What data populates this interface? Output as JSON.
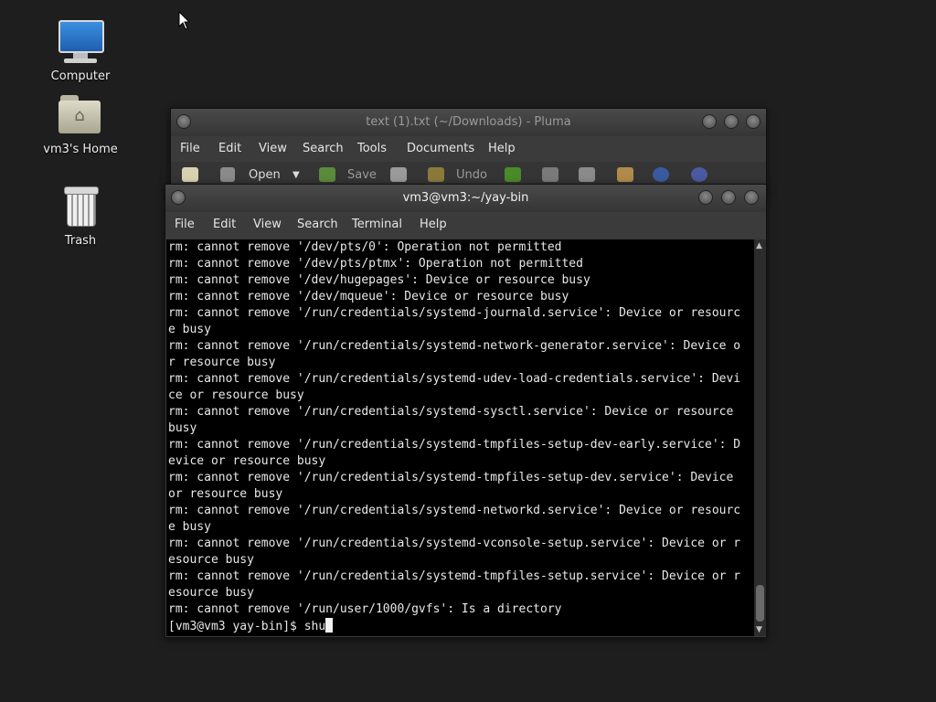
{
  "desktop": {
    "icons": [
      {
        "label": "Computer",
        "icon": "computer-icon"
      },
      {
        "label": "vm3's Home",
        "icon": "home-folder-icon"
      },
      {
        "label": "Trash",
        "icon": "trash-icon"
      }
    ]
  },
  "pluma": {
    "title": "text (1).txt (~/Downloads) - Pluma",
    "menu": [
      "File",
      "Edit",
      "View",
      "Search",
      "Tools",
      "Documents",
      "Help"
    ],
    "toolbar": {
      "open_label": "Open",
      "save_label": "Save",
      "undo_label": "Undo"
    }
  },
  "terminal": {
    "title": "vm3@vm3:~/yay-bin",
    "menu": [
      "File",
      "Edit",
      "View",
      "Search",
      "Terminal",
      "Help"
    ],
    "lines": [
      "rm: cannot remove '/dev/pts/0': Operation not permitted",
      "rm: cannot remove '/dev/pts/ptmx': Operation not permitted",
      "rm: cannot remove '/dev/hugepages': Device or resource busy",
      "rm: cannot remove '/dev/mqueue': Device or resource busy",
      "rm: cannot remove '/run/credentials/systemd-journald.service': Device or resourc",
      "e busy",
      "rm: cannot remove '/run/credentials/systemd-network-generator.service': Device o",
      "r resource busy",
      "rm: cannot remove '/run/credentials/systemd-udev-load-credentials.service': Devi",
      "ce or resource busy",
      "rm: cannot remove '/run/credentials/systemd-sysctl.service': Device or resource",
      "busy",
      "rm: cannot remove '/run/credentials/systemd-tmpfiles-setup-dev-early.service': D",
      "evice or resource busy",
      "rm: cannot remove '/run/credentials/systemd-tmpfiles-setup-dev.service': Device",
      "or resource busy",
      "rm: cannot remove '/run/credentials/systemd-networkd.service': Device or resourc",
      "e busy",
      "rm: cannot remove '/run/credentials/systemd-vconsole-setup.service': Device or r",
      "esource busy",
      "rm: cannot remove '/run/credentials/systemd-tmpfiles-setup.service': Device or r",
      "esource busy",
      "rm: cannot remove '/run/user/1000/gvfs': Is a directory"
    ],
    "prompt": "[vm3@vm3 yay-bin]$ ",
    "input": "shu"
  },
  "colors": {
    "desktop_bg": "#1e1e1e",
    "terminal_bg": "#000000",
    "titlebar": "#3a3a3a"
  }
}
